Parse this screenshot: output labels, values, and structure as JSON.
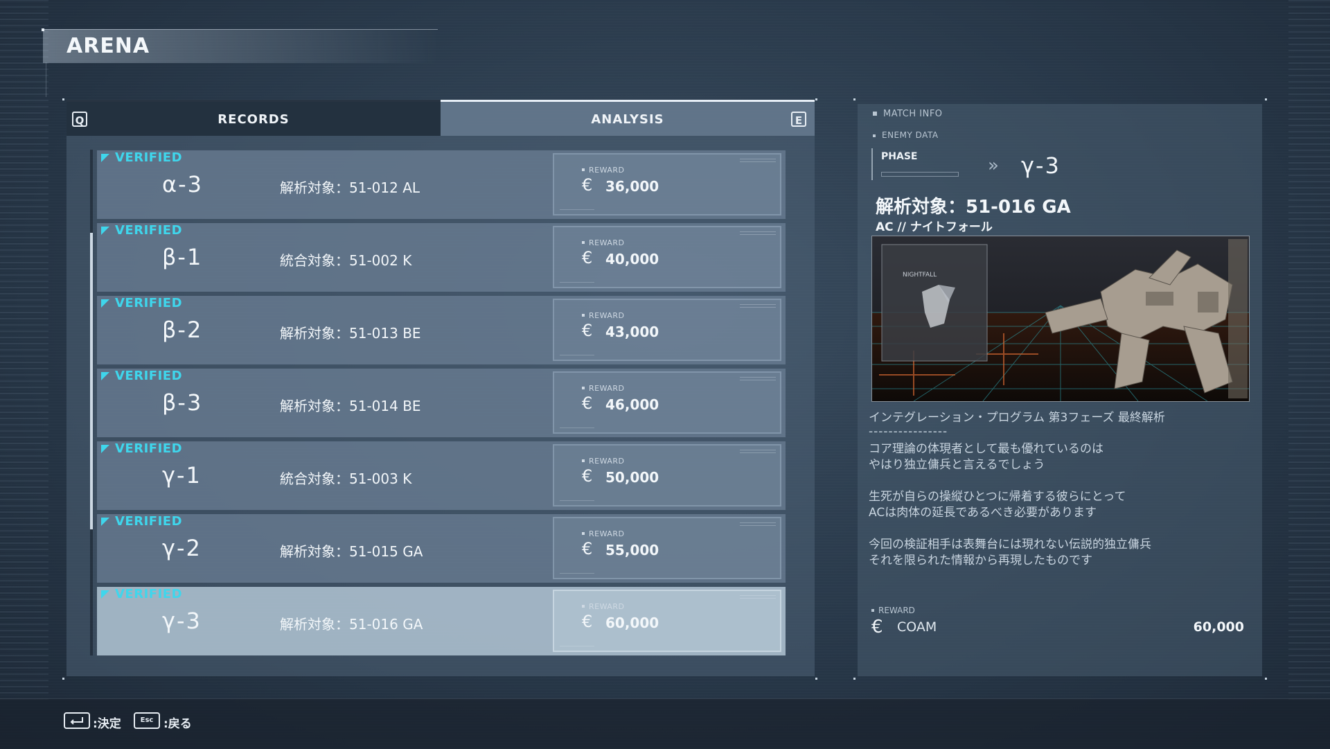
{
  "screen_title": "ARENA",
  "tabs": {
    "left_key": "Q",
    "right_key": "E",
    "records_label": "RECORDS",
    "analysis_label": "ANALYSIS",
    "active": "ANALYSIS"
  },
  "rows": [
    {
      "status": "VERIFIED",
      "code": "α-3",
      "target": "解析対象：51-012 AL",
      "reward_label": "REWARD",
      "currency": "€",
      "reward": "36,000"
    },
    {
      "status": "VERIFIED",
      "code": "β-1",
      "target": "統合対象：51-002 K",
      "reward_label": "REWARD",
      "currency": "€",
      "reward": "40,000"
    },
    {
      "status": "VERIFIED",
      "code": "β-2",
      "target": "解析対象：51-013 BE",
      "reward_label": "REWARD",
      "currency": "€",
      "reward": "43,000"
    },
    {
      "status": "VERIFIED",
      "code": "β-3",
      "target": "解析対象：51-014 BE",
      "reward_label": "REWARD",
      "currency": "€",
      "reward": "46,000"
    },
    {
      "status": "VERIFIED",
      "code": "γ-1",
      "target": "統合対象：51-003 K",
      "reward_label": "REWARD",
      "currency": "€",
      "reward": "50,000"
    },
    {
      "status": "VERIFIED",
      "code": "γ-2",
      "target": "解析対象：51-015 GA",
      "reward_label": "REWARD",
      "currency": "€",
      "reward": "55,000"
    },
    {
      "status": "VERIFIED",
      "code": "γ-3",
      "target": "解析対象：51-016 GA",
      "reward_label": "REWARD",
      "currency": "€",
      "reward": "60,000"
    }
  ],
  "selected_row": 6,
  "detail": {
    "match_info_label": "MATCH INFO",
    "enemy_data_label": "ENEMY DATA",
    "phase_label": "PHASE",
    "phase_arrow": "»",
    "phase_value": "γ-3",
    "enemy_name": "解析対象：51-016 GA",
    "enemy_subtitle": "AC // ナイトフォール",
    "image_caption": "NIGHTFALL",
    "description_heading": "インテグレーション・プログラム 第3フェーズ 最終解析",
    "description_rule": "----------------",
    "description_p1": "コア理論の体現者として最も優れているのは\nやはり独立傭兵と言えるでしょう",
    "description_p2": "生死が自らの操縦ひとつに帰着する彼らにとって\nACは肉体の延長であるべき必要があります",
    "description_p3": "今回の検証相手は表舞台には現れない伝説的独立傭兵\nそれを限られた情報から再現したものです",
    "reward_label": "REWARD",
    "reward_currency": "€",
    "reward_name": "COAM",
    "reward_value": "60,000"
  },
  "footer": {
    "confirm_label": ":決定",
    "esc_key_label": "Esc",
    "back_label": ":戻る"
  },
  "colors": {
    "accent_cyan": "#3fd6ec",
    "panel": "#4f6276",
    "selected_row": "#a8bccb"
  }
}
